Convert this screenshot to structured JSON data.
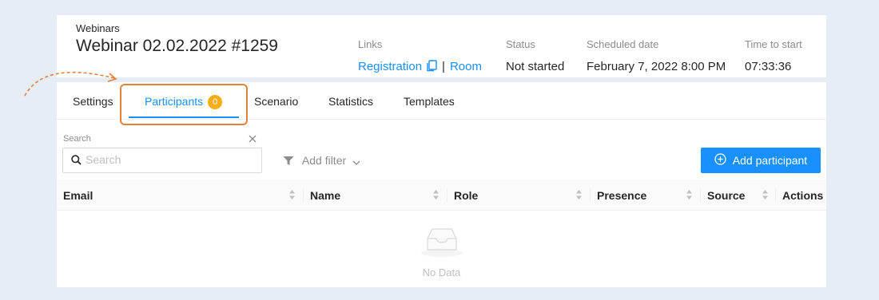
{
  "header": {
    "breadcrumb": "Webinars",
    "title": "Webinar 02.02.2022 #1259",
    "links_label": "Links",
    "registration_link": "Registration",
    "link_separator": "|",
    "room_link": "Room",
    "status_label": "Status",
    "status_value": "Not started",
    "scheduled_label": "Scheduled date",
    "scheduled_value": "February 7, 2022 8:00 PM",
    "time_to_start_label": "Time to start",
    "time_to_start_value": "07:33:36"
  },
  "tabs": [
    {
      "label": "Settings"
    },
    {
      "label": "Participants",
      "badge": "0",
      "active": true
    },
    {
      "label": "Scenario"
    },
    {
      "label": "Statistics"
    },
    {
      "label": "Templates"
    }
  ],
  "search": {
    "label": "Search",
    "placeholder": "Search",
    "value": ""
  },
  "filter": {
    "label": "Add filter"
  },
  "actions": {
    "add_participant_label": "Add participant"
  },
  "table": {
    "columns": [
      "Email",
      "Name",
      "Role",
      "Presence",
      "Source",
      "Actions"
    ],
    "rows": [],
    "empty_text": "No Data"
  },
  "colors": {
    "accent": "#1890ff",
    "badge": "#faad14",
    "highlight": "#e0823d",
    "background": "#e6edf6"
  }
}
